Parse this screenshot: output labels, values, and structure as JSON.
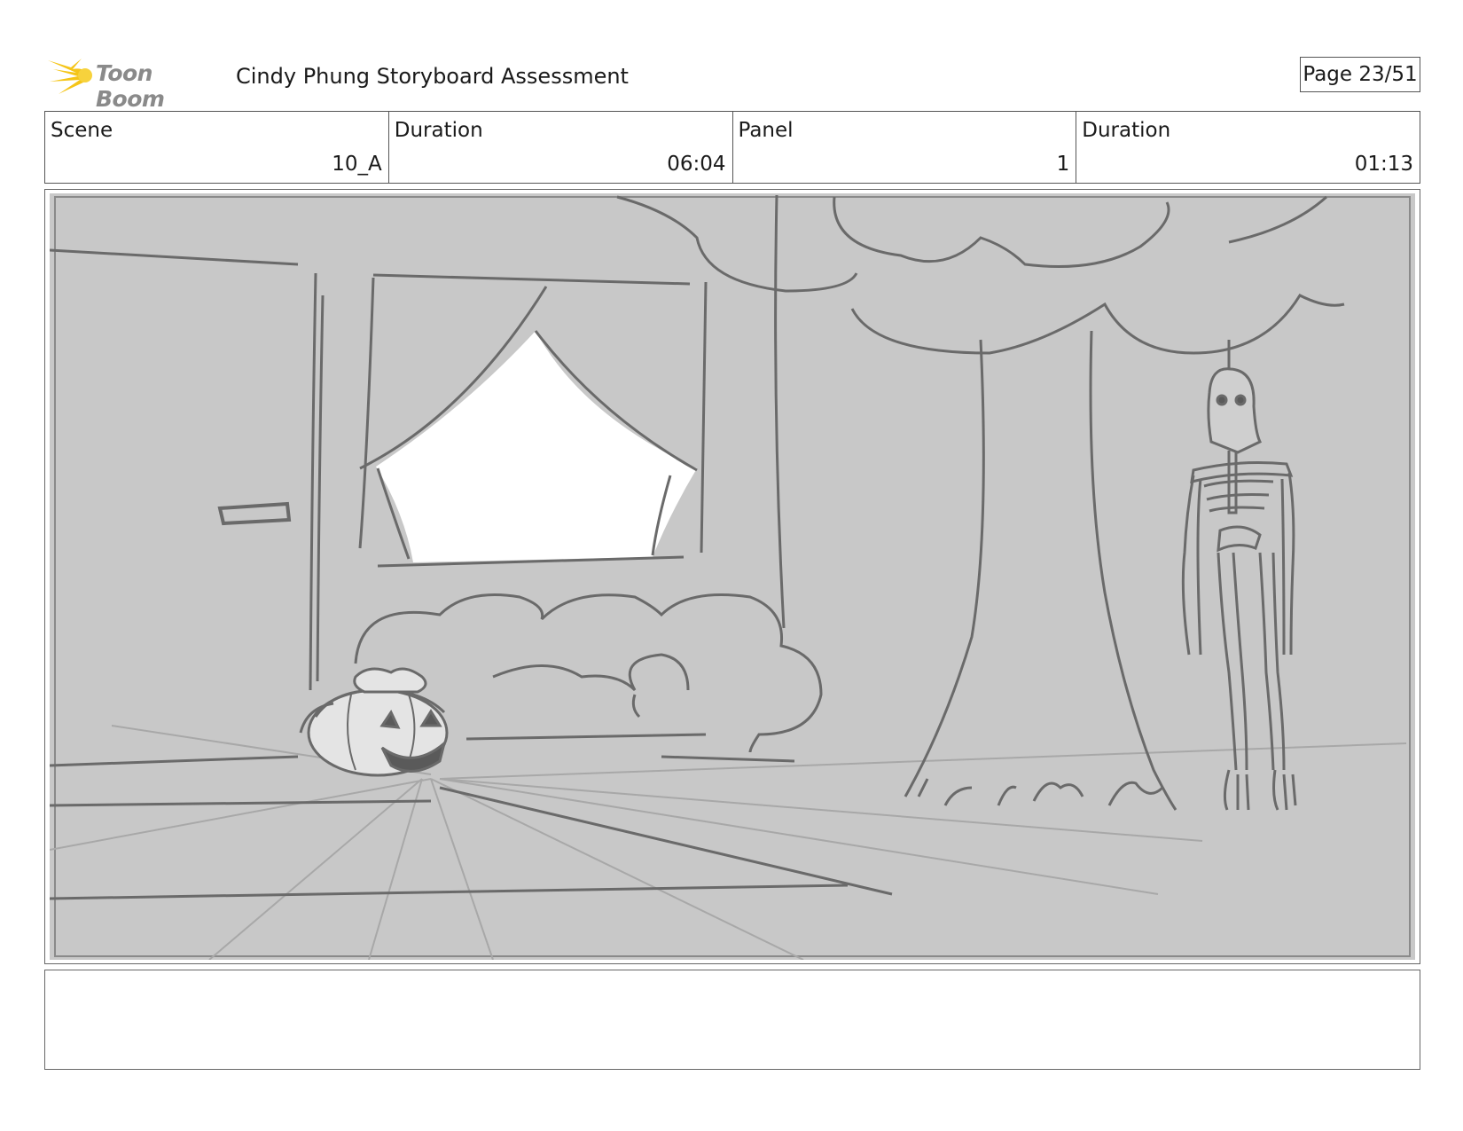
{
  "header": {
    "logo_text": "Toon Boom",
    "title": "Cindy Phung Storyboard Assessment",
    "page": "Page 23/51"
  },
  "info": {
    "scene_label": "Scene",
    "scene_value": "10_A",
    "scene_duration_label": "Duration",
    "scene_duration_value": "06:04",
    "panel_label": "Panel",
    "panel_value": "1",
    "panel_duration_label": "Duration",
    "panel_duration_value": "01:13"
  },
  "panel": {
    "content": [
      "curtained-window",
      "door-handle",
      "bush",
      "jack-o-lantern-candy-bucket",
      "tree",
      "hanging-skeleton"
    ]
  },
  "notes": {
    "text": ""
  },
  "colors": {
    "sketch_bg": "#c8c8c8",
    "sketch_line": "#6a6a6a",
    "logo_flame": "#f5c518"
  }
}
